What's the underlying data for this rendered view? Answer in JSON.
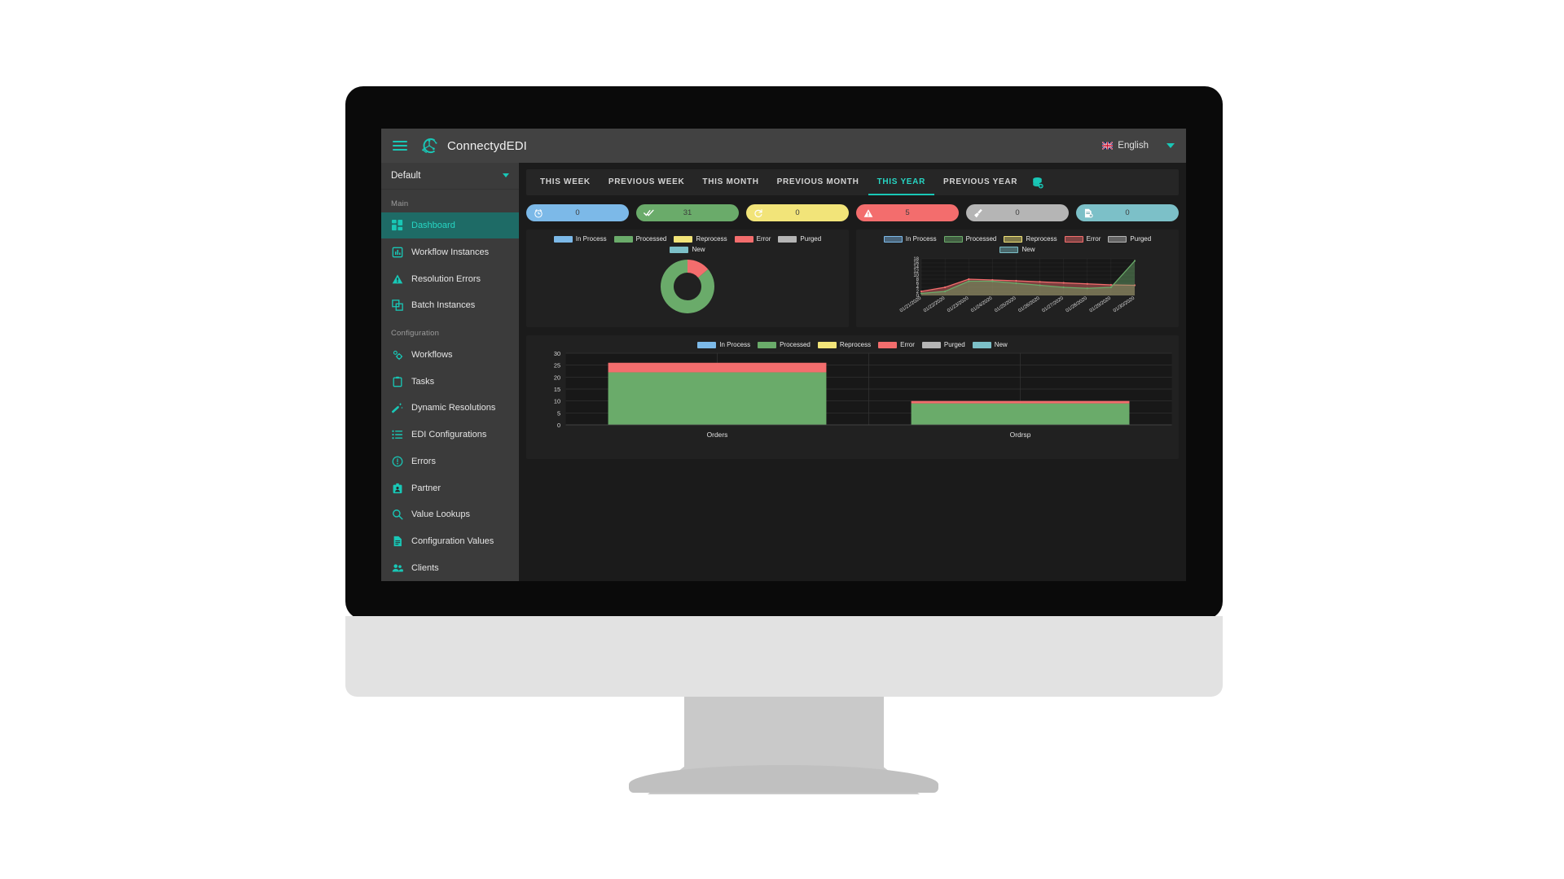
{
  "topbar": {
    "brand": "ConnectydEDI",
    "menu_icon": "hamburger-icon",
    "logo_icon": "connectyd-logo-icon",
    "language": "English",
    "flag_icon": "uk-flag-icon",
    "caret_icon": "chevron-down-icon"
  },
  "sidebar": {
    "profile": {
      "value": "Default",
      "caret_icon": "chevron-down-icon"
    },
    "sections": [
      {
        "label": "Main",
        "items": [
          {
            "label": "Dashboard",
            "icon": "dashboard-grid-icon",
            "active": true
          },
          {
            "label": "Workflow Instances",
            "icon": "bar-chart-icon",
            "active": false
          },
          {
            "label": "Resolution Errors",
            "icon": "warning-triangle-icon",
            "active": false
          },
          {
            "label": "Batch Instances",
            "icon": "batch-squares-icon",
            "active": false
          }
        ]
      },
      {
        "label": "Configuration",
        "items": [
          {
            "label": "Workflows",
            "icon": "gears-icon",
            "active": false
          },
          {
            "label": "Tasks",
            "icon": "clipboard-icon",
            "active": false
          },
          {
            "label": "Dynamic Resolutions",
            "icon": "magic-wand-icon",
            "active": false
          },
          {
            "label": "EDI Configurations",
            "icon": "list-icon",
            "active": false
          },
          {
            "label": "Errors",
            "icon": "exclamation-circle-icon",
            "active": false
          },
          {
            "label": "Partner",
            "icon": "badge-person-icon",
            "active": false
          },
          {
            "label": "Value Lookups",
            "icon": "search-icon",
            "active": false
          },
          {
            "label": "Configuration Values",
            "icon": "document-lines-icon",
            "active": false
          },
          {
            "label": "Clients",
            "icon": "people-icon",
            "active": false
          }
        ]
      }
    ]
  },
  "tabs": {
    "items": [
      {
        "label": "THIS WEEK",
        "active": false
      },
      {
        "label": "PREVIOUS WEEK",
        "active": false
      },
      {
        "label": "THIS MONTH",
        "active": false
      },
      {
        "label": "PREVIOUS MONTH",
        "active": false
      },
      {
        "label": "THIS YEAR",
        "active": true
      },
      {
        "label": "PREVIOUS YEAR",
        "active": false
      }
    ],
    "database_icon": "database-refresh-icon"
  },
  "status_chips": [
    {
      "name": "in-process",
      "value": "0",
      "color": "#7cb9e8",
      "icon": "clock-icon"
    },
    {
      "name": "processed",
      "value": "31",
      "color": "#6aab6a",
      "icon": "double-check-icon"
    },
    {
      "name": "reprocess",
      "value": "0",
      "color": "#f2e479",
      "icon": "refresh-icon"
    },
    {
      "name": "error",
      "value": "5",
      "color": "#f36d6d",
      "icon": "warning-triangle-icon"
    },
    {
      "name": "purged",
      "value": "0",
      "color": "#b5b5b5",
      "icon": "broom-icon"
    },
    {
      "name": "new",
      "value": "0",
      "color": "#7cc0c8",
      "icon": "new-document-icon"
    }
  ],
  "legend_series": [
    {
      "label": "In Process",
      "color": "#7cb9e8"
    },
    {
      "label": "Processed",
      "color": "#6aab6a"
    },
    {
      "label": "Reprocess",
      "color": "#f2e479"
    },
    {
      "label": "Error",
      "color": "#f36d6d"
    },
    {
      "label": "Purged",
      "color": "#b5b5b5"
    },
    {
      "label": "New",
      "color": "#7cc0c8"
    }
  ],
  "chart_data": [
    {
      "id": "donut",
      "type": "pie",
      "title": "",
      "legend_position": "top",
      "categories": [
        "In Process",
        "Processed",
        "Reprocess",
        "Error",
        "Purged",
        "New"
      ],
      "values": [
        0,
        31,
        0,
        5,
        0,
        0
      ],
      "colors": [
        "#7cb9e8",
        "#6aab6a",
        "#f2e479",
        "#f36d6d",
        "#b5b5b5",
        "#7cc0c8"
      ],
      "total": 36
    },
    {
      "id": "area-timeseries",
      "type": "area",
      "title": "",
      "legend_position": "top",
      "xlabel": "",
      "ylabel": "",
      "grid": true,
      "ylim": [
        0,
        18
      ],
      "yticks": [
        0,
        2,
        4,
        6,
        8,
        10,
        12,
        14,
        16,
        18
      ],
      "x": [
        "01/21/2020",
        "01/22/2020",
        "01/23/2020",
        "01/24/2020",
        "01/25/2020",
        "01/26/2020",
        "01/27/2020",
        "01/28/2020",
        "01/29/2020",
        "01/30/2020"
      ],
      "series": [
        {
          "name": "Processed",
          "color": "#6aab6a",
          "values": [
            1,
            2,
            7,
            7,
            6,
            5,
            4,
            3.5,
            4,
            17
          ]
        },
        {
          "name": "Error",
          "color": "#f36d6d",
          "values": [
            2,
            4,
            8,
            7.6,
            7.2,
            6.7,
            6.2,
            5.7,
            5.2,
            5
          ]
        }
      ]
    },
    {
      "id": "stacked-bars",
      "type": "bar",
      "title": "",
      "legend_position": "top",
      "stacked": true,
      "xlabel": "",
      "ylabel": "",
      "grid": true,
      "ylim": [
        0,
        30
      ],
      "yticks": [
        0,
        5,
        10,
        15,
        20,
        25,
        30
      ],
      "categories": [
        "Orders",
        "Ordrsp"
      ],
      "series": [
        {
          "name": "Processed",
          "color": "#6aab6a",
          "values": [
            22,
            9
          ]
        },
        {
          "name": "Error",
          "color": "#f36d6d",
          "values": [
            4,
            1
          ]
        }
      ]
    }
  ]
}
